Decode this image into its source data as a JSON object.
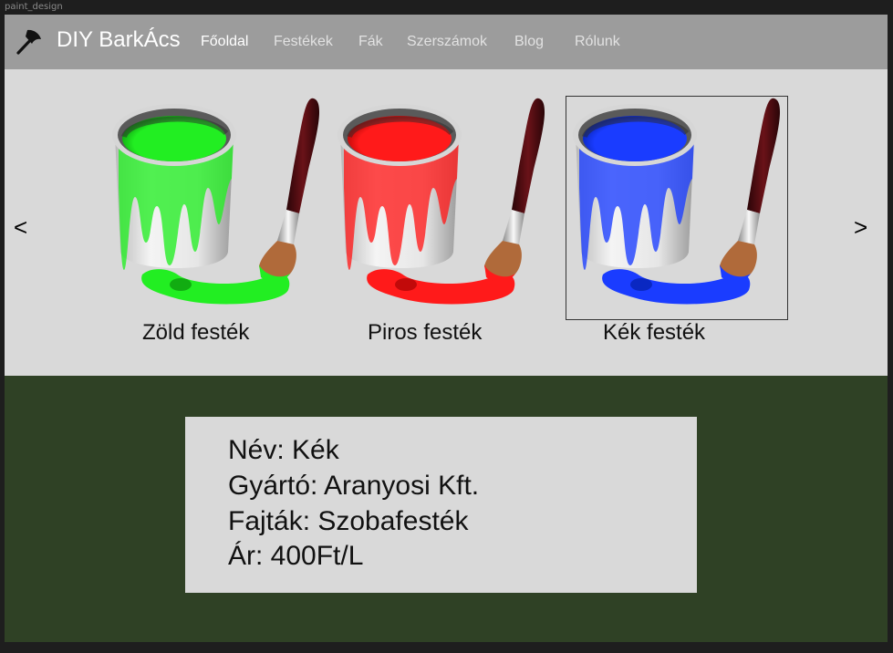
{
  "window": {
    "title": "paint_design"
  },
  "brand": {
    "name": "DIY BarkÁcs",
    "icon": "axe-icon"
  },
  "nav": {
    "items": [
      {
        "label": "Főoldal",
        "active": true
      },
      {
        "label": "Festékek",
        "active": false
      },
      {
        "label": "Fák",
        "active": false
      },
      {
        "label": "Szerszámok",
        "active": false
      },
      {
        "label": "Blog",
        "active": false
      },
      {
        "label": "Rólunk",
        "active": false
      }
    ]
  },
  "carousel": {
    "prev": "<",
    "next": ">",
    "selected_index": 2,
    "items": [
      {
        "caption": "Zöld festék",
        "color": "#22ee22",
        "dark": "#078007",
        "icon": "paint-bucket-brush-icon"
      },
      {
        "caption": "Piros festék",
        "color": "#ff1a1a",
        "dark": "#990000",
        "icon": "paint-bucket-brush-icon"
      },
      {
        "caption": "Kék festék",
        "color": "#1a3cff",
        "dark": "#001a99",
        "icon": "paint-bucket-brush-icon"
      }
    ]
  },
  "details": {
    "name": "Név: Kék",
    "manufacturer": "Gyártó: Aranyosi Kft.",
    "types": "Fajták: Szobafesték",
    "price": "Ár: 400Ft/L"
  },
  "colors": {
    "navbar": "#9c9c9c",
    "footer": "#2f4125",
    "panel": "#d9d9d9"
  }
}
